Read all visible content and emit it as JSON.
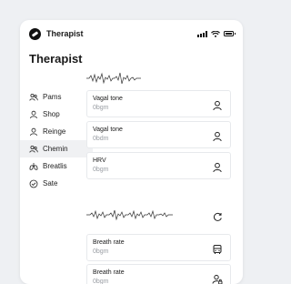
{
  "app": {
    "name": "Therapist",
    "logo_icon": "app-logo-icon"
  },
  "status": {
    "signal_icon": "signal-icon",
    "wifi_icon": "wifi-icon",
    "battery_icon": "battery-icon"
  },
  "page": {
    "title": "Therapist"
  },
  "sidebar": {
    "items": [
      {
        "label": "Pams",
        "icon": "people-icon"
      },
      {
        "label": "Shop",
        "icon": "user-icon"
      },
      {
        "label": "Reinge",
        "icon": "user-icon"
      },
      {
        "label": "Chemin",
        "icon": "people-icon",
        "active": true
      },
      {
        "label": "Breatlis",
        "icon": "lungs-icon"
      },
      {
        "label": "Sate",
        "icon": "check-circle-icon"
      }
    ]
  },
  "cards": [
    {
      "title": "Vagal tone",
      "value": "0bgm",
      "icon": "user-icon"
    },
    {
      "title": "Vagal tone",
      "value": "0bdm",
      "icon": "user-icon"
    },
    {
      "title": "HRV",
      "value": "0bgm",
      "icon": "user-icon"
    },
    {
      "title": "Breath rate",
      "value": "0bgm",
      "icon": "bus-icon"
    },
    {
      "title": "Breath rate",
      "value": "0bgm",
      "icon": "user-lock-icon"
    }
  ],
  "colors": {
    "background": "#eef0f3",
    "panel": "#ffffff",
    "active": "#f0f1f3",
    "muted": "#9a9ea4"
  }
}
